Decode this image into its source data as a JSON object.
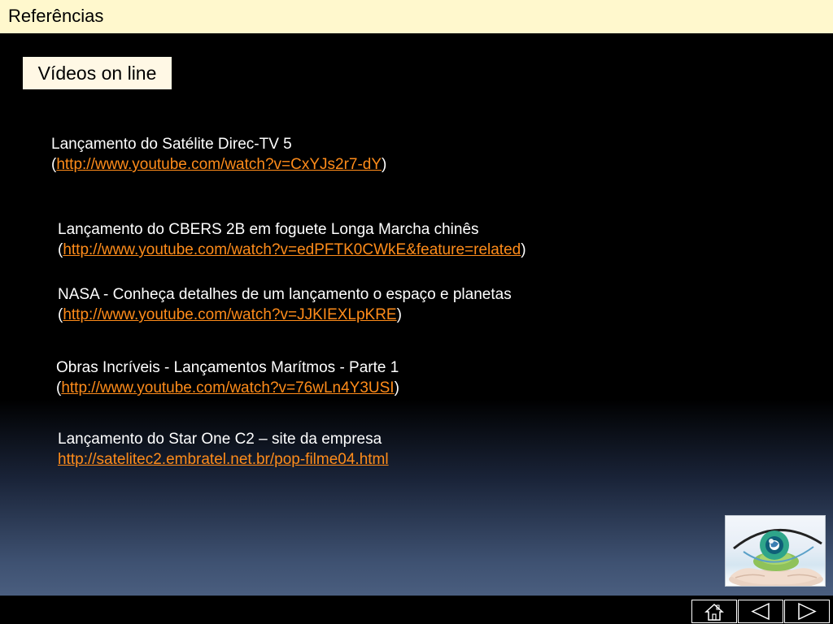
{
  "header": {
    "title": "Referências"
  },
  "section": {
    "label": "Vídeos on line"
  },
  "refs": [
    {
      "title": "Lançamento do Satélite Direc-TV 5",
      "open": "(",
      "url": "http://www.youtube.com/watch?v=CxYJs2r7-dY",
      "close": ")"
    },
    {
      "title": "Lançamento do CBERS 2B em foguete Longa Marcha chinês",
      "open": "(",
      "url": "http://www.youtube.com/watch?v=edPFTK0CWkE&feature=related",
      "close": ")"
    },
    {
      "title": "NASA - Conheça detalhes de um lançamento o espaço e planetas",
      "open": "(",
      "url": "http://www.youtube.com/watch?v=JJKIEXLpKRE",
      "close": ")"
    },
    {
      "title": "Obras Incríveis - Lançamentos Marítmos - Parte 1",
      "open": "(",
      "url": "http://www.youtube.com/watch?v=76wLn4Y3USI",
      "close": ")"
    },
    {
      "title": "Lançamento do Star One C2 – site da empresa",
      "url": "http://satelitec2.embratel.net.br/pop-filme04.html"
    }
  ],
  "nav": {
    "home_icon": "home-icon",
    "prev_icon": "triangle-left-icon",
    "next_icon": "triangle-right-icon"
  },
  "colors": {
    "header_bg": "#fff8cd",
    "label_bg": "#fff8e5",
    "link": "#ff8c1a",
    "text": "#ffffff",
    "gradient_bottom": "#4a5e7f"
  }
}
